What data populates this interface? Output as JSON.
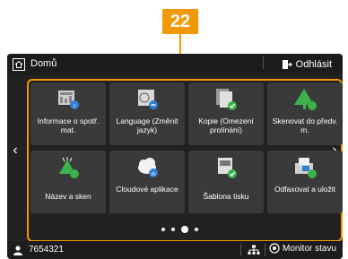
{
  "callout": {
    "label": "22"
  },
  "header": {
    "title": "Domů",
    "logout_label": "Odhlásit"
  },
  "tiles": [
    {
      "label": "Informace o spotř. mat.",
      "icon": "consumables-info-icon"
    },
    {
      "label": "Language (Změnit jazyk)",
      "icon": "language-icon"
    },
    {
      "label": "Kopie (Omezení prolínání)",
      "icon": "copy-icon"
    },
    {
      "label": "Skenovat do předv. m.",
      "icon": "scan-tree-icon"
    },
    {
      "label": "Název a sken",
      "icon": "name-scan-icon"
    },
    {
      "label": "Cloudové aplikace",
      "icon": "cloud-icon"
    },
    {
      "label": "Šablona tisku",
      "icon": "print-template-icon"
    },
    {
      "label": "Odfaxovat a uložit",
      "icon": "fax-save-icon"
    }
  ],
  "pager": {
    "page_count": 4,
    "active_index": 2
  },
  "footer": {
    "user_id": "7654321",
    "monitor_label": "Monitor stavu"
  },
  "colors": {
    "accent": "#f39800",
    "screen_bg": "#222222",
    "tile_bg": "#3a3a3a",
    "badge_green": "#3cb44b",
    "badge_blue": "#2f7fd6"
  }
}
